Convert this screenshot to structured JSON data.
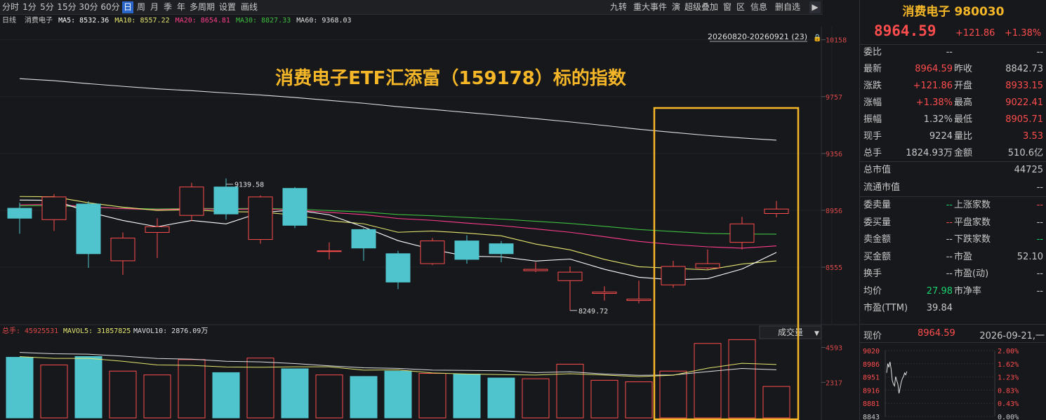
{
  "toolbar": {
    "periods": [
      "分时",
      "1分",
      "5分",
      "15分",
      "30分",
      "60分",
      "日",
      "周",
      "月",
      "季",
      "年",
      "多周期",
      "设置",
      "画线"
    ],
    "active_period": "日",
    "right_tools": [
      "九转",
      "重大事件",
      "演",
      "超级叠加",
      "窗",
      "区",
      "信息",
      "删自选"
    ],
    "expand_icon": "collapse-right-icon"
  },
  "info": {
    "period_label": "日线",
    "name": "消费电子",
    "ma5": "MA5: 8532.36",
    "ma10": "MA10: 8557.22",
    "ma20": "MA20: 8654.81",
    "ma30": "MA30: 8827.33",
    "ma60": "MA60: 9368.03"
  },
  "colors": {
    "up": "#ff4d4d",
    "down": "#4fc4cc",
    "ma5": "#ffffff",
    "ma10": "#e6e66e",
    "ma20": "#ff3d8b",
    "ma30": "#3fbf3f",
    "ma60": "#e0e0e0",
    "highlight": "#f5b728",
    "title": "#f5b728"
  },
  "chart": {
    "date_range": "20260820-20260921 (23)",
    "title": "消费电子ETF汇添富（159178）标的指数",
    "price_axis": [
      "10158",
      "9757",
      "9356",
      "8956",
      "8555"
    ],
    "max_label": "9139.58",
    "min_label": "8249.72",
    "candles": [
      {
        "o": 8970,
        "c": 8900,
        "h": 9010,
        "l": 8790
      },
      {
        "o": 8890,
        "c": 9050,
        "h": 9070,
        "l": 8810
      },
      {
        "o": 9000,
        "c": 8650,
        "h": 9020,
        "l": 8550
      },
      {
        "o": 8600,
        "c": 8760,
        "h": 8800,
        "l": 8500
      },
      {
        "o": 8800,
        "c": 8840,
        "h": 8900,
        "l": 8620
      },
      {
        "o": 8920,
        "c": 9120,
        "h": 9150,
        "l": 8880
      },
      {
        "o": 9120,
        "c": 8930,
        "h": 9180,
        "l": 8890
      },
      {
        "o": 8750,
        "c": 9050,
        "h": 9060,
        "l": 8720
      },
      {
        "o": 9110,
        "c": 8850,
        "h": 9120,
        "l": 8830
      },
      {
        "o": 8670,
        "c": 8670,
        "h": 8730,
        "l": 8610
      },
      {
        "o": 8820,
        "c": 8690,
        "h": 8830,
        "l": 8600
      },
      {
        "o": 8650,
        "c": 8450,
        "h": 8670,
        "l": 8400
      },
      {
        "o": 8580,
        "c": 8740,
        "h": 8760,
        "l": 8570
      },
      {
        "o": 8740,
        "c": 8610,
        "h": 8780,
        "l": 8580
      },
      {
        "o": 8720,
        "c": 8650,
        "h": 8740,
        "l": 8590
      },
      {
        "o": 8530,
        "c": 8540,
        "h": 8590,
        "l": 8520
      },
      {
        "o": 8460,
        "c": 8520,
        "h": 8560,
        "l": 8250
      },
      {
        "o": 8370,
        "c": 8380,
        "h": 8420,
        "l": 8320
      },
      {
        "o": 8320,
        "c": 8330,
        "h": 8460,
        "l": 8300
      },
      {
        "o": 8430,
        "c": 8560,
        "h": 8600,
        "l": 8410
      },
      {
        "o": 8550,
        "c": 8580,
        "h": 8680,
        "l": 8540
      },
      {
        "o": 8730,
        "c": 8860,
        "h": 8910,
        "l": 8680
      },
      {
        "o": 8933.15,
        "c": 8964.59,
        "h": 9022.41,
        "l": 8905.71
      }
    ],
    "volume_label": "总手: 45925531",
    "mavol5": "MAVOL5: 31857825",
    "mavol10": "MAVOL10: 2876.09万",
    "volume_select": "成交量",
    "volume_axis": [
      "4593",
      "2317"
    ],
    "volumes": [
      3950,
      3450,
      4000,
      3050,
      2800,
      3800,
      2950,
      3900,
      3200,
      2800,
      2700,
      3050,
      2900,
      2850,
      2600,
      2550,
      3500,
      2450,
      2350,
      3050,
      4850,
      5100,
      2050
    ]
  },
  "quote": {
    "title": "消费电子 980030",
    "price": "8964.59",
    "change": "+121.86",
    "change_pct": "+1.38%",
    "rows": [
      {
        "l": "委比",
        "v": "--",
        "l2": "",
        "v2": "--",
        "c": "",
        "c2": ""
      },
      {
        "l": "最新",
        "v": "8964.59",
        "l2": "昨收",
        "v2": "8842.73",
        "c": "red",
        "c2": ""
      },
      {
        "l": "涨跌",
        "v": "+121.86",
        "l2": "开盘",
        "v2": "8933.15",
        "c": "red",
        "c2": "red"
      },
      {
        "l": "涨幅",
        "v": "+1.38%",
        "l2": "最高",
        "v2": "9022.41",
        "c": "red",
        "c2": "red"
      },
      {
        "l": "振幅",
        "v": "1.32%",
        "l2": "最低",
        "v2": "8905.71",
        "c": "",
        "c2": "red"
      },
      {
        "l": "现手",
        "v": "9224",
        "l2": "量比",
        "v2": "3.53",
        "c": "",
        "c2": "red"
      },
      {
        "l": "总手",
        "v": "1824.93万",
        "l2": "金额",
        "v2": "510.6亿",
        "c": "",
        "c2": ""
      }
    ],
    "market_cap_label": "总市值",
    "market_cap": "44725",
    "float_cap_label": "流通市值",
    "float_cap": "--",
    "rows2": [
      {
        "l": "委卖量",
        "v": "--",
        "l2": "上涨家数",
        "v2": "--",
        "c": "green",
        "c2": "red"
      },
      {
        "l": "委买量",
        "v": "--",
        "l2": "平盘家数",
        "v2": "--",
        "c": "red",
        "c2": ""
      },
      {
        "l": "卖金额",
        "v": "--",
        "l2": "下跌家数",
        "v2": "--",
        "c": "",
        "c2": "green"
      },
      {
        "l": "买金额",
        "v": "--",
        "l2": "市盈",
        "v2": "52.10",
        "c": "",
        "c2": ""
      },
      {
        "l": "换手",
        "v": "--",
        "l2": "市盈(动)",
        "v2": "--",
        "c": "",
        "c2": ""
      },
      {
        "l": "均价",
        "v": "27.98",
        "l2": "市净率",
        "v2": "--",
        "c": "green",
        "c2": ""
      },
      {
        "l": "市盈(TTM)",
        "v": "39.84",
        "l2": "",
        "v2": "",
        "c": "",
        "c2": ""
      }
    ],
    "mini_label": "现价",
    "mini_price": "8964.59",
    "mini_time": "2026-09-21,一",
    "mini_left": [
      "9020",
      "8986",
      "8951",
      "8916",
      "8881",
      "8843"
    ],
    "mini_right": [
      "2.00%",
      "1.62%",
      "1.23%",
      "0.83%",
      "0.43%",
      "0.00%"
    ],
    "mini_series": [
      8960,
      8985,
      8975,
      8990,
      8970,
      8940,
      8930,
      8925,
      8950,
      8940,
      8930,
      8905,
      8920,
      8935,
      8945,
      8950,
      8960,
      8955,
      8964
    ]
  }
}
